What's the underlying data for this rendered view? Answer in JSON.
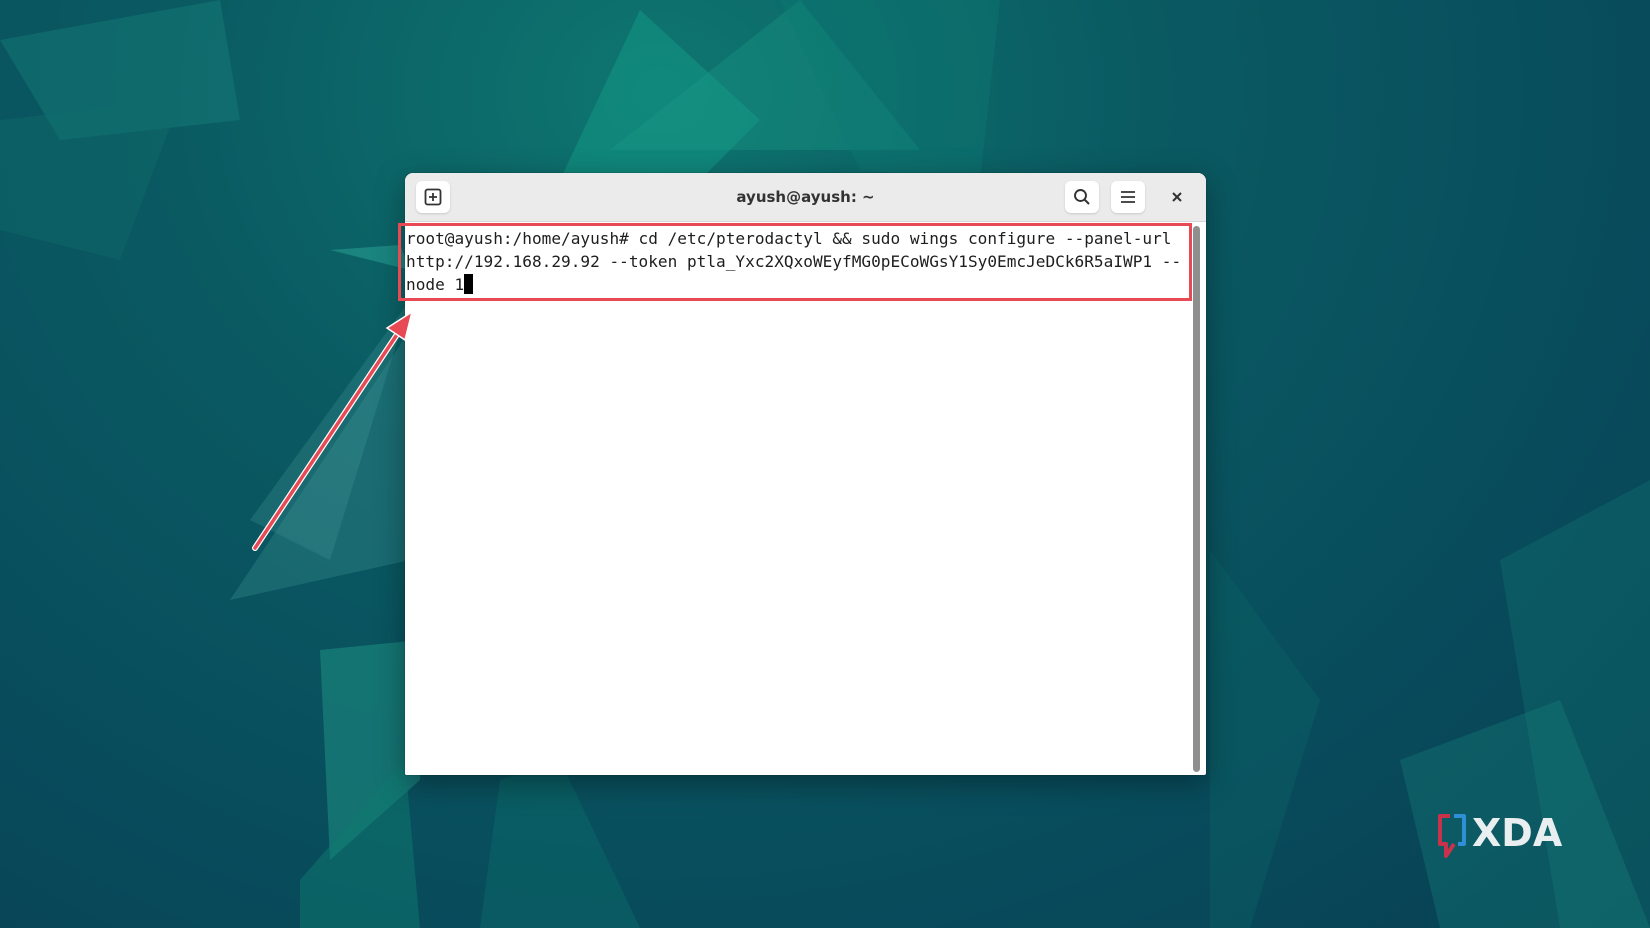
{
  "window": {
    "title": "ayush@ayush: ~"
  },
  "terminal": {
    "lines": [
      "root@ayush:/home/ayush# cd /etc/pterodactyl && sudo wings configure --panel-url",
      "http://192.168.29.92 --token ptla_Yxc2XQxoWEyfMG0pECoWGsY1Sy0EmcJeDCk6R5aIWP1 --",
      "node 1"
    ]
  },
  "icons": {
    "new_tab": "new-tab-icon",
    "search": "search-icon",
    "menu": "hamburger-menu-icon",
    "close": "close-icon"
  },
  "watermark": {
    "brand": "XDA"
  },
  "colors": {
    "highlight": "#e84a55",
    "wallpaper": "#0a5a62",
    "titlebar": "#ebebeb"
  }
}
